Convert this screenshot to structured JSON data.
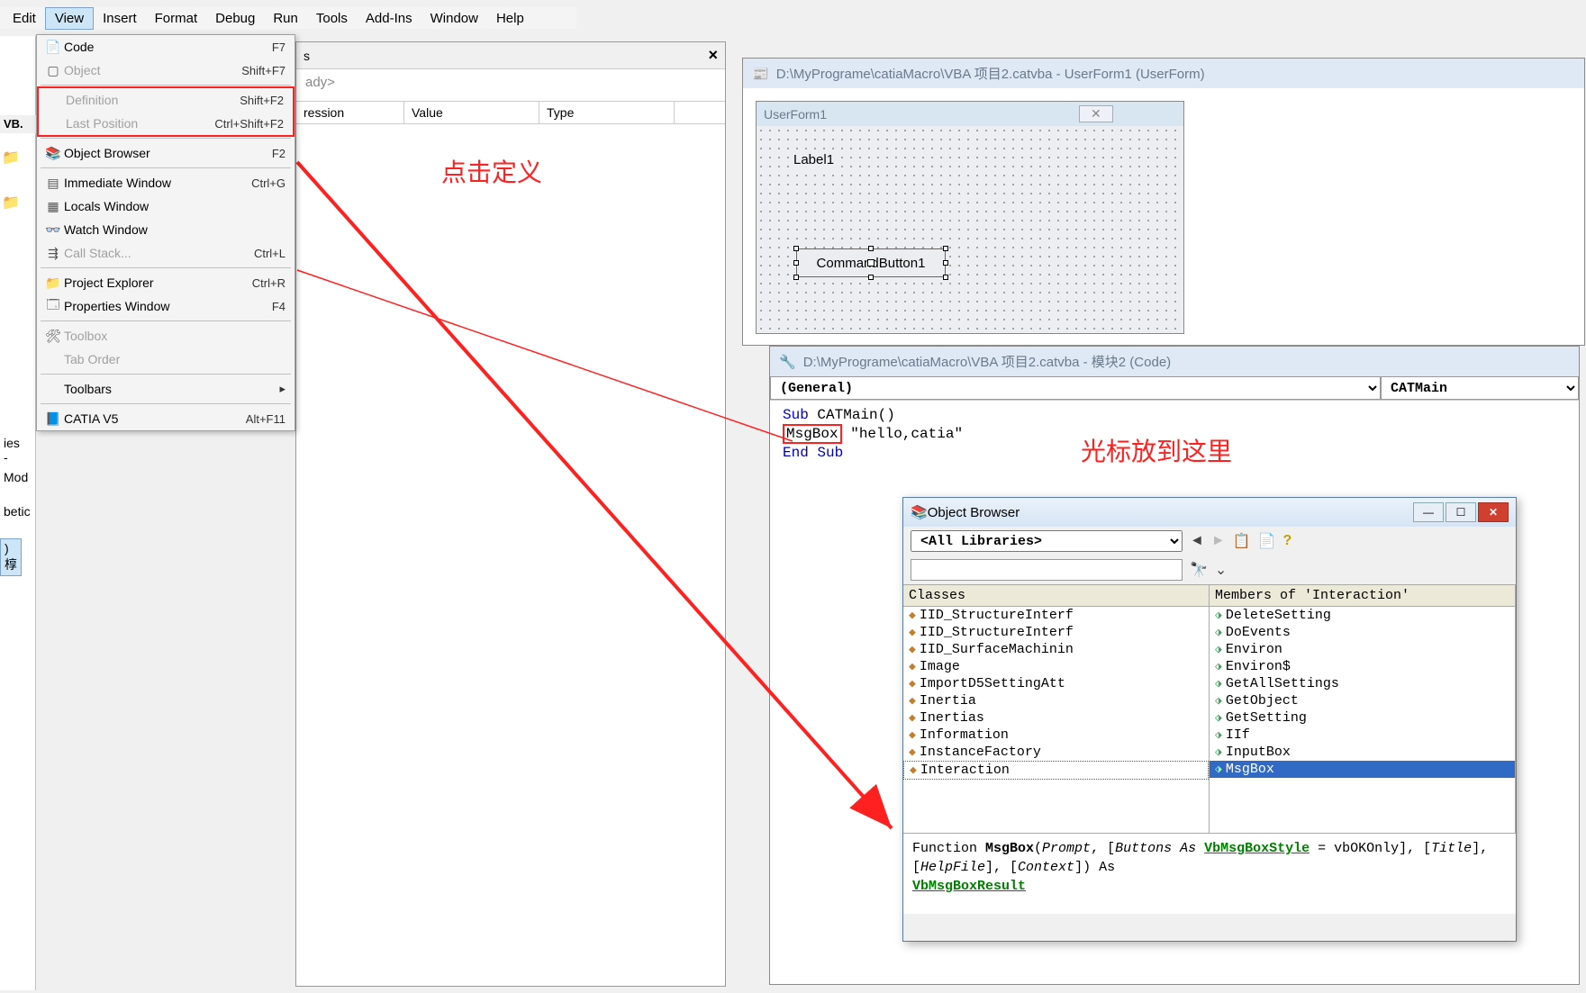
{
  "menubar": [
    "Edit",
    "View",
    "Insert",
    "Format",
    "Debug",
    "Run",
    "Tools",
    "Add-Ins",
    "Window",
    "Help"
  ],
  "vb_label": "- VB",
  "view_menu": {
    "code": {
      "label": "Code",
      "shortcut": "F7"
    },
    "object": {
      "label": "Object",
      "shortcut": "Shift+F7"
    },
    "definition": {
      "label": "Definition",
      "shortcut": "Shift+F2"
    },
    "lastpos": {
      "label": "Last Position",
      "shortcut": "Ctrl+Shift+F2"
    },
    "objbrowser": {
      "label": "Object Browser",
      "shortcut": "F2"
    },
    "immediate": {
      "label": "Immediate Window",
      "shortcut": "Ctrl+G"
    },
    "locals": {
      "label": "Locals Window",
      "shortcut": ""
    },
    "watch": {
      "label": "Watch Window",
      "shortcut": ""
    },
    "callstack": {
      "label": "Call Stack...",
      "shortcut": "Ctrl+L"
    },
    "projexp": {
      "label": "Project Explorer",
      "shortcut": "Ctrl+R"
    },
    "propwin": {
      "label": "Properties Window",
      "shortcut": "F4"
    },
    "toolbox": {
      "label": "Toolbox",
      "shortcut": ""
    },
    "taborder": {
      "label": "Tab Order",
      "shortcut": ""
    },
    "toolbars": {
      "label": "Toolbars",
      "shortcut": "▸"
    },
    "catia": {
      "label": "CATIA V5",
      "shortcut": "Alt+F11"
    }
  },
  "left_title": "VB.",
  "sidelabels": {
    "ies": "ies -",
    "mod": "Mod",
    "betic": "betic",
    "hou": ") 椁"
  },
  "watch_pane": {
    "title_suffix": "s",
    "ready": "ady>",
    "col_expr": "ression",
    "col_value": "Value",
    "col_type": "Type"
  },
  "annot": {
    "click_def": "点击定义",
    "cursor_here": "光标放到这里"
  },
  "form_window": {
    "title": "D:\\MyPrograme\\catiaMacro\\VBA 项目2.catvba - UserForm1 (UserForm)",
    "caption": "UserForm1",
    "label1": "Label1",
    "cmdbtn": "CommandButton1"
  },
  "code_window": {
    "title": "D:\\MyPrograme\\catiaMacro\\VBA 项目2.catvba - 模块2 (Code)",
    "combo_left": "(General)",
    "combo_right": "CATMain",
    "line1_a": "Sub",
    "line1_b": "CATMain()",
    "line2_a": "MsgBox",
    "line2_b": "\"hello,catia\"",
    "line3": "End Sub"
  },
  "objbrowser": {
    "title": "Object Browser",
    "lib": "<All Libraries>",
    "classes_hdr": "Classes",
    "members_hdr": "Members of 'Interaction'",
    "classes": [
      "IID_StructureInterf",
      "IID_StructureInterf",
      "IID_SurfaceMachinin",
      "Image",
      "ImportD5SettingAtt",
      "Inertia",
      "Inertias",
      "Information",
      "InstanceFactory",
      "Interaction"
    ],
    "members": [
      "DeleteSetting",
      "DoEvents",
      "Environ",
      "Environ$",
      "GetAllSettings",
      "GetObject",
      "GetSetting",
      "IIf",
      "InputBox",
      "MsgBox"
    ],
    "detail_fn": "Function ",
    "detail_name": "MsgBox",
    "detail_p1": "(",
    "detail_prompt": "Prompt",
    "detail_p2": ", [",
    "detail_buttons": "Buttons As ",
    "detail_style": "VbMsgBoxStyle",
    "detail_p3": " = vbOKOnly], [",
    "detail_title": "Title",
    "detail_p4": "], [",
    "detail_help": "HelpFile",
    "detail_p5": "], [",
    "detail_ctx": "Context",
    "detail_p6": "]) As ",
    "detail_result": "VbMsgBoxResult"
  }
}
